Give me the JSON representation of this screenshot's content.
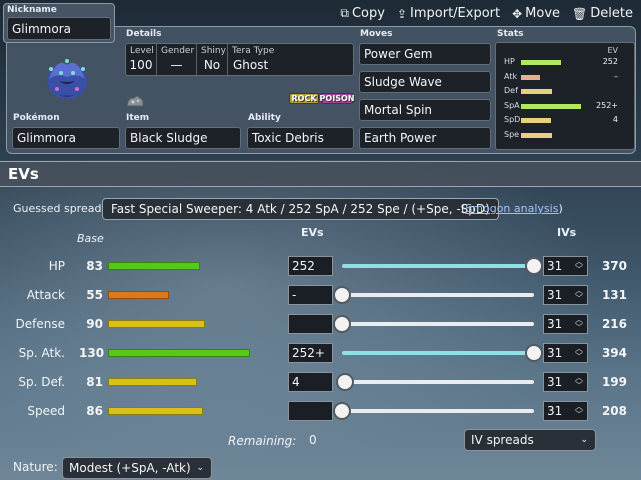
{
  "toolbar": {
    "copy": "Copy",
    "import_export": "Import/Export",
    "move": "Move",
    "delete": "Delete"
  },
  "set": {
    "nickname_label": "Nickname",
    "nickname": "Glimmora",
    "details_label": "Details",
    "level_label": "Level",
    "level": "100",
    "gender_label": "Gender",
    "gender": "—",
    "shiny_label": "Shiny",
    "shiny": "No",
    "tera_label": "Tera Type",
    "tera": "Ghost",
    "types": [
      "ROCK",
      "POISON"
    ],
    "type_colors": [
      "#b8a038",
      "#a040a0"
    ],
    "pokemon_label": "Pokémon",
    "pokemon": "Glimmora",
    "item_label": "Item",
    "item": "Black Sludge",
    "ability_label": "Ability",
    "ability": "Toxic Debris",
    "moves_label": "Moves",
    "moves": [
      "Power Gem",
      "Sludge Wave",
      "Mortal Spin",
      "Earth Power"
    ],
    "stats_label": "Stats",
    "stats_ev_header": "EV",
    "stats": [
      {
        "name": "HP",
        "ev": "252",
        "bar": 0.45,
        "color": "#b0e860"
      },
      {
        "name": "Atk",
        "ev": "–",
        "bar": 0.22,
        "color": "#e8b088"
      },
      {
        "name": "Def",
        "ev": "",
        "bar": 0.35,
        "color": "#e8d080"
      },
      {
        "name": "SpA",
        "ev": "252+",
        "bar": 0.68,
        "color": "#b0e860"
      },
      {
        "name": "SpD",
        "ev": "4",
        "bar": 0.34,
        "color": "#e8d080"
      },
      {
        "name": "Spe",
        "ev": "",
        "bar": 0.35,
        "color": "#e8d080"
      }
    ]
  },
  "evs": {
    "title": "EVs",
    "guessed_label": "Guessed spread:",
    "guessed_spread": "Fast Special Sweeper: 4 Atk / 252 SpA / 252 Spe / (+Spe, -SpD)",
    "paren_open": "(",
    "analysis_link": "Smogon analysis",
    "paren_close": ")",
    "col_base": "Base",
    "col_evs": "EVs",
    "col_ivs": "IVs",
    "rows": [
      {
        "label": "HP",
        "base": "83",
        "base_fill": 0.33,
        "base_color": "#55c91a",
        "ev": "252",
        "slider": 1.0,
        "iv": "31",
        "total": "370"
      },
      {
        "label": "Attack",
        "base": "55",
        "base_fill": 0.22,
        "base_color": "#e07818",
        "ev": "-",
        "slider": 0.0,
        "iv": "31",
        "total": "131"
      },
      {
        "label": "Defense",
        "base": "90",
        "base_fill": 0.35,
        "base_color": "#d8c018",
        "ev": "",
        "slider": 0.0,
        "iv": "31",
        "total": "216"
      },
      {
        "label": "Sp. Atk.",
        "base": "130",
        "base_fill": 0.51,
        "base_color": "#55c91a",
        "ev": "252+",
        "slider": 1.0,
        "iv": "31",
        "total": "394"
      },
      {
        "label": "Sp. Def.",
        "base": "81",
        "base_fill": 0.32,
        "base_color": "#d8c018",
        "ev": "4",
        "slider": 0.016,
        "iv": "31",
        "total": "199"
      },
      {
        "label": "Speed",
        "base": "86",
        "base_fill": 0.34,
        "base_color": "#d8c018",
        "ev": "",
        "slider": 0.0,
        "iv": "31",
        "total": "208"
      }
    ],
    "remaining_label": "Remaining:",
    "remaining": "0",
    "iv_spreads": "IV spreads",
    "nature_label": "Nature:",
    "nature": "Modest (+SpA, -Atk)"
  }
}
